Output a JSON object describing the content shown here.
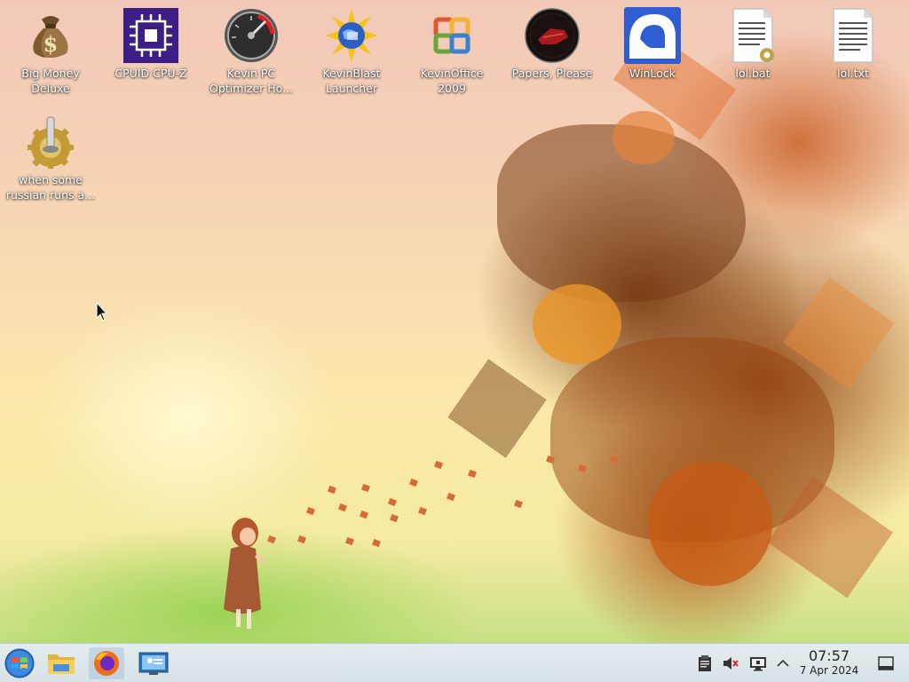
{
  "desktop": {
    "icons": [
      {
        "label": "Big Money\nDeluxe",
        "icon": "money-bag-icon"
      },
      {
        "label": "CPUID CPU-Z",
        "icon": "cpu-chip-icon"
      },
      {
        "label": "Kevin PC\nOptimizer Ho...",
        "icon": "speedometer-icon"
      },
      {
        "label": "KevinBlast\nLauncher",
        "icon": "starburst-globe-icon"
      },
      {
        "label": "KevinOffice\n2009",
        "icon": "office-logo-icon"
      },
      {
        "label": "Papers, Please",
        "icon": "stamp-logo-icon"
      },
      {
        "label": "WinLock",
        "icon": "lock-shackle-icon"
      },
      {
        "label": "lol.bat",
        "icon": "batch-file-icon"
      },
      {
        "label": "lol.txt",
        "icon": "text-file-icon"
      },
      {
        "label": "when some\nrussian runs a...",
        "icon": "joystick-gear-icon"
      }
    ]
  },
  "taskbar": {
    "start_icon": "start-orb-icon",
    "pinned": [
      {
        "icon": "file-manager-icon"
      },
      {
        "icon": "firefox-icon"
      },
      {
        "icon": "remote-desktop-icon"
      }
    ],
    "tray": {
      "icons": [
        "clipboard-icon",
        "volume-muted-icon",
        "display-icon",
        "chevron-up-icon"
      ]
    },
    "clock": {
      "time": "07:57",
      "date": "7 Apr 2024"
    },
    "show_desktop_icon": "show-desktop-icon"
  }
}
